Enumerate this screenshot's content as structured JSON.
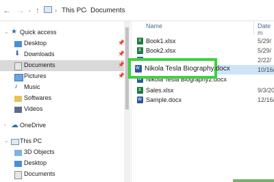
{
  "breadcrumb": {
    "this_pc": "This PC",
    "documents": "Documents"
  },
  "nav_pane": [
    {
      "label": "Quick access",
      "icon": "star-icon",
      "pinned": false
    },
    {
      "label": "Desktop",
      "icon": "desktop-folder-icon",
      "pinned": true
    },
    {
      "label": "Downloads",
      "icon": "downloads-folder-icon",
      "pinned": true
    },
    {
      "label": "Documents",
      "icon": "documents-folder-icon",
      "pinned": true,
      "selected": true
    },
    {
      "label": "Pictures",
      "icon": "pictures-folder-icon",
      "pinned": true
    },
    {
      "label": "Music",
      "icon": "music-icon",
      "pinned": false
    },
    {
      "label": "Softwares",
      "icon": "folder-icon",
      "pinned": false
    },
    {
      "label": "Videos",
      "icon": "videos-folder-icon",
      "pinned": false
    },
    {
      "label": "OneDrive",
      "icon": "onedrive-icon",
      "pinned": false
    },
    {
      "label": "This PC",
      "icon": "pc-icon",
      "pinned": false
    },
    {
      "label": "3D Objects",
      "icon": "3d-objects-icon",
      "pinned": false
    },
    {
      "label": "Desktop",
      "icon": "desktop-folder-icon",
      "pinned": false
    },
    {
      "label": "Documents",
      "icon": "documents-folder-icon",
      "pinned": false
    }
  ],
  "columns": {
    "name": "Name",
    "date": "Date m"
  },
  "files": [
    {
      "name": "Book1.xlsx",
      "date": "5/29/",
      "type": "xlsx"
    },
    {
      "name": "Book2.xlsx",
      "date": "5/29/",
      "type": "xlsx"
    },
    {
      "name": "",
      "date": "2/22/",
      "type": "docx"
    },
    {
      "name": "",
      "date": "10/16/",
      "type": "docx",
      "selected": true
    },
    {
      "name": "Nikola Tesla Biography2.docx",
      "date": "",
      "type": "docx"
    },
    {
      "name": "Sales.xlsx",
      "date": "9/3/20",
      "type": "xlsx"
    },
    {
      "name": "Sample.docx",
      "date": "12/16/",
      "type": "docx"
    }
  ],
  "highlight": {
    "name": "Nikola Tesla Biography.docx",
    "color": "#3ed13e"
  },
  "colors": {
    "selection": "#cce4f7",
    "nav_selection": "#d9d9d9"
  }
}
